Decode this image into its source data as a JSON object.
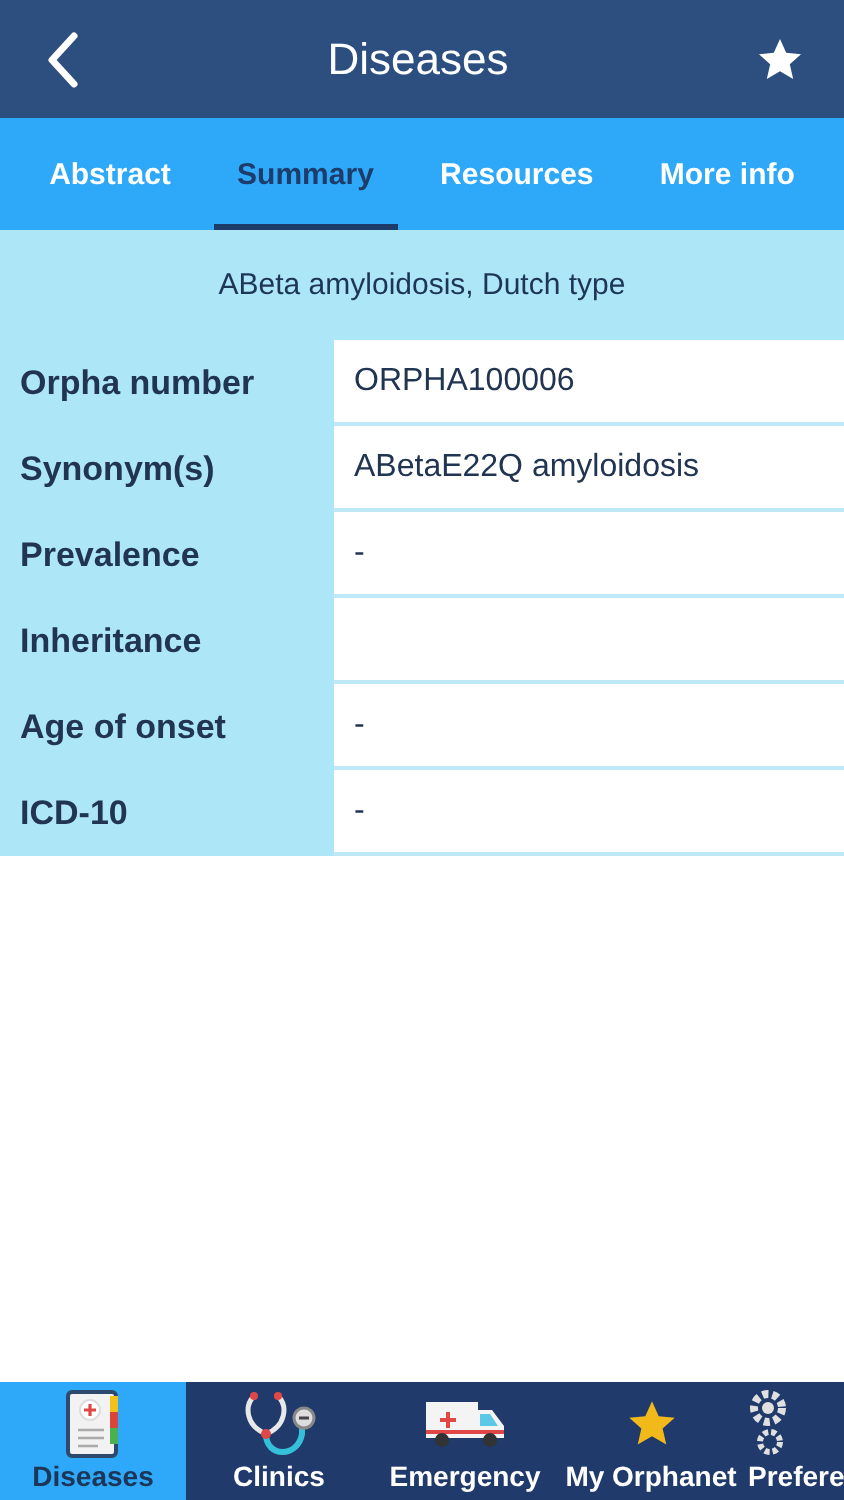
{
  "header": {
    "title": "Diseases"
  },
  "tabs": [
    {
      "label": "Abstract",
      "selected": false
    },
    {
      "label": "Summary",
      "selected": true
    },
    {
      "label": "Resources",
      "selected": false
    },
    {
      "label": "More info",
      "selected": false
    }
  ],
  "disease_title": "ABeta amyloidosis, Dutch type",
  "rows": [
    {
      "label": "Orpha number",
      "value": "ORPHA100006"
    },
    {
      "label": "Synonym(s)",
      "value": "ABetaE22Q amyloidosis"
    },
    {
      "label": "Prevalence",
      "value": "-"
    },
    {
      "label": "Inheritance"
    },
    {
      "label": "Age of onset",
      "value": "-"
    },
    {
      "label": "ICD-10",
      "value": "-"
    }
  ],
  "tab_bar": [
    {
      "kind": "diseases",
      "label": "Diseases",
      "selected": true
    },
    {
      "kind": "clinics",
      "label": "Clinics",
      "selected": false
    },
    {
      "kind": "emergency",
      "label": "Emergency",
      "selected": false
    },
    {
      "kind": "favorites",
      "label": "My Orphanet",
      "selected": false
    },
    {
      "kind": "preferences",
      "label": "Prefere",
      "selected": false
    }
  ]
}
